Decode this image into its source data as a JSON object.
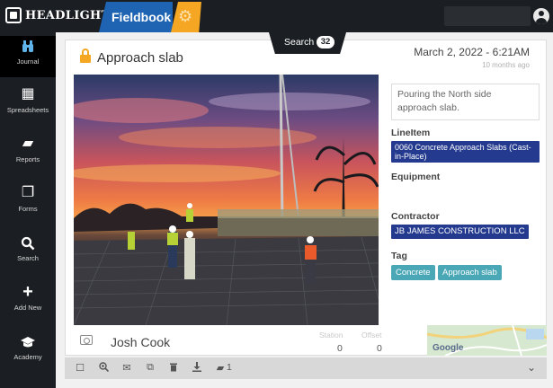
{
  "brand": {
    "logo_text": "HEADLIGHT",
    "app_name": "Fieldbook"
  },
  "sidebar": {
    "items": [
      {
        "label": "Journal",
        "icon": "binoculars-icon",
        "active": true
      },
      {
        "label": "Spreadsheets",
        "icon": "grid-icon"
      },
      {
        "label": "Reports",
        "icon": "report-icon"
      },
      {
        "label": "Forms",
        "icon": "forms-icon"
      },
      {
        "label": "Search",
        "icon": "search-icon"
      },
      {
        "label": "Add New",
        "icon": "plus-icon"
      },
      {
        "label": "Academy",
        "icon": "graduation-cap-icon"
      }
    ]
  },
  "entry": {
    "title": "Approach slab",
    "search_label": "Search",
    "search_count": "32",
    "date": "March 2, 2022 - 6:21AM",
    "age": "10 months ago",
    "description": "Pouring the North side approach slab.",
    "line_item_label": "LineItem",
    "line_item_value": "0060 Concrete Approach Slabs (Cast-in-Place)",
    "equipment_label": "Equipment",
    "contractor_label": "Contractor",
    "contractor_value": "JB JAMES CONSTRUCTION LLC",
    "tag_label": "Tag",
    "tags": [
      "Concrete",
      "Approach slab"
    ],
    "author": "Josh Cook",
    "station_label": "Station",
    "station_value": "0",
    "offset_label": "Offset",
    "offset_value": "0",
    "map_label": "Google"
  },
  "toolbar": {
    "pages_count": "1"
  },
  "colors": {
    "topbar": "#1b1e22",
    "app_tab": "#1f64b3",
    "accent": "#f5a623",
    "chip_blue": "#233a8f",
    "chip_teal": "#4aa7b5"
  }
}
